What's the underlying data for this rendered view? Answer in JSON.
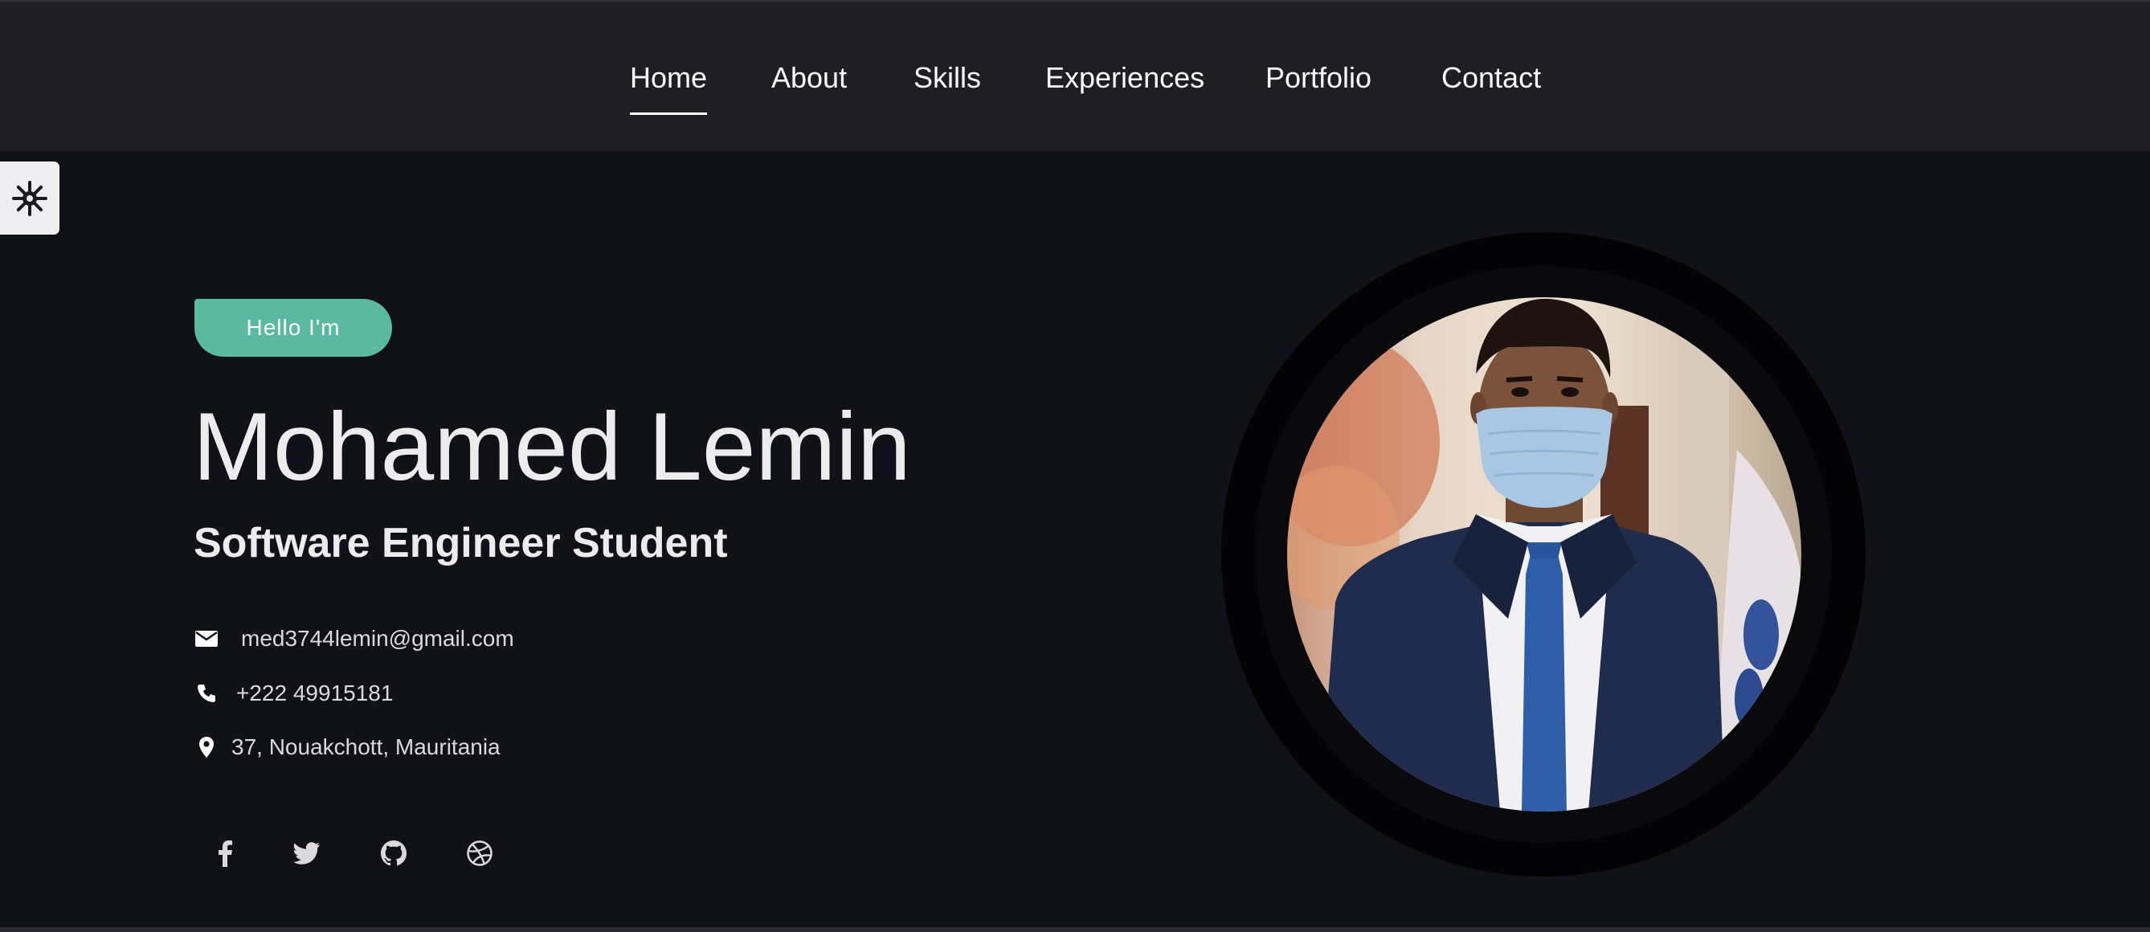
{
  "nav": {
    "items": [
      {
        "label": "Home",
        "active": true
      },
      {
        "label": "About"
      },
      {
        "label": "Skills"
      },
      {
        "label": "Experiences"
      },
      {
        "label": "Portfolio"
      },
      {
        "label": "Contact"
      }
    ]
  },
  "settings": {
    "icon": "gear-icon"
  },
  "hero": {
    "greeting": "Hello I'm",
    "name": "Mohamed Lemin",
    "title": "Software Engineer Student",
    "contacts": [
      {
        "icon": "envelope-icon",
        "text": "med3744lemin@gmail.com"
      },
      {
        "icon": "phone-icon",
        "text": "+222 49915181"
      },
      {
        "icon": "map-marker-icon",
        "text": "37, Nouakchott, Mauritania"
      }
    ],
    "social": [
      "facebook-icon",
      "twitter-icon",
      "github-icon",
      "dribbble-icon"
    ]
  },
  "colors": {
    "background": "#11111a",
    "navbar": "#1e1e24",
    "accent": "#5ab9a0",
    "text": "#ececef"
  }
}
